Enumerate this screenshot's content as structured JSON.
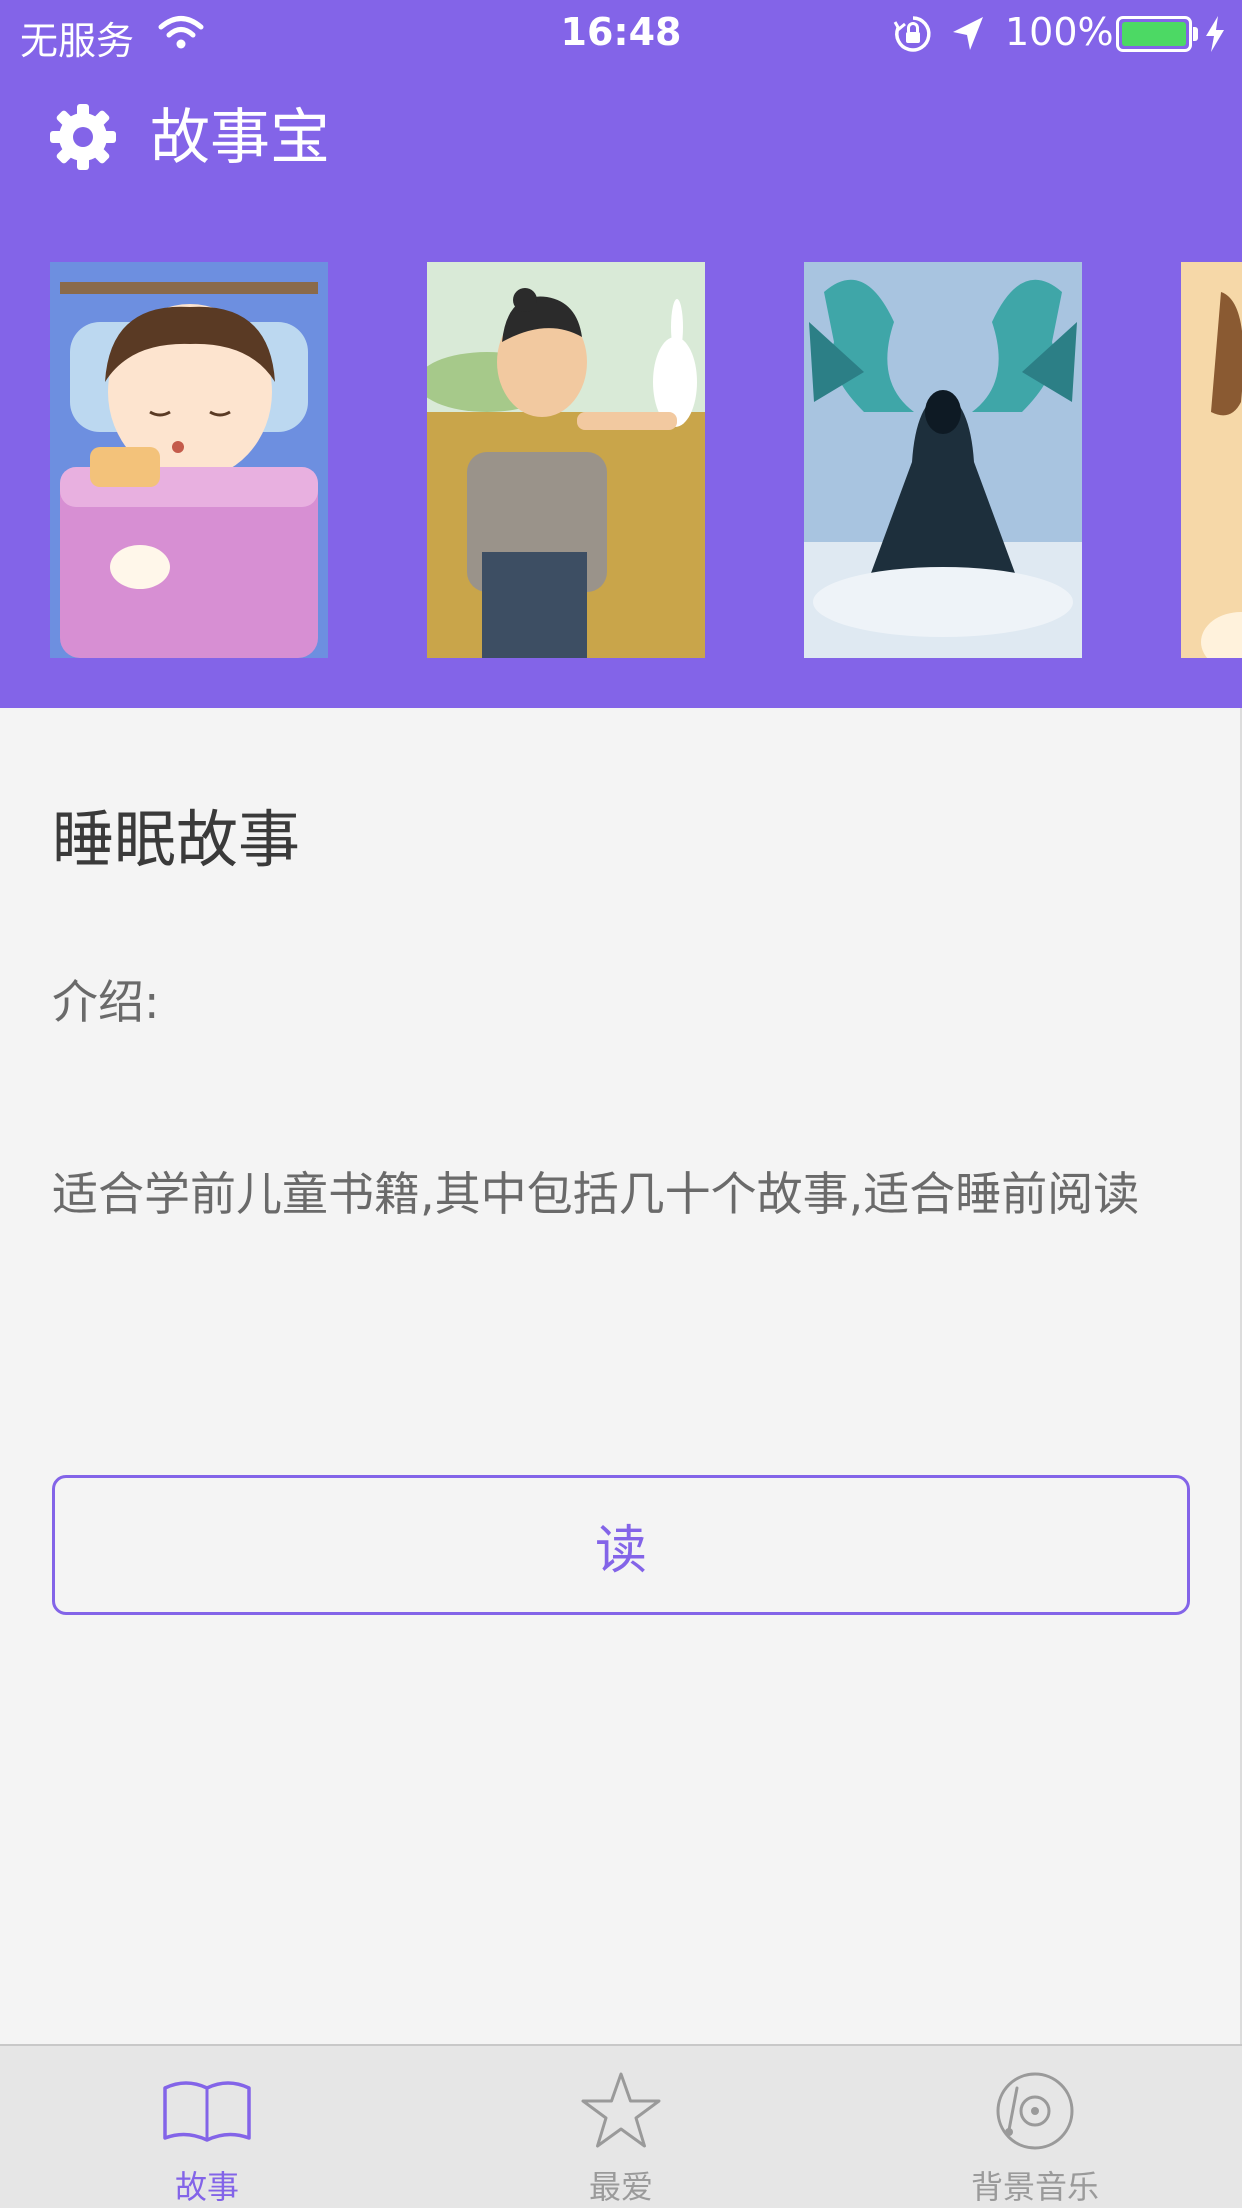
{
  "status_bar": {
    "carrier": "无服务",
    "time": "16:48",
    "battery_percent": "100%",
    "battery_level": 1.0,
    "icons": [
      "wifi-icon",
      "orientation-lock-icon",
      "location-icon",
      "battery-icon",
      "charging-icon"
    ]
  },
  "nav": {
    "title": "故事宝",
    "settings_icon": "gear-icon"
  },
  "colors": {
    "accent": "#8364e8",
    "background": "#f4f4f4",
    "battery_fill": "#4cd964",
    "tab_inactive": "#9a9a9a"
  },
  "carousel": {
    "covers": [
      {
        "name": "sleeping-child-cover"
      },
      {
        "name": "farmer-rabbit-cover"
      },
      {
        "name": "dragon-wizard-cover"
      },
      {
        "name": "partial-cover"
      }
    ]
  },
  "book": {
    "title": "睡眠故事",
    "intro_label": "介绍:",
    "description": "适合学前儿童书籍,其中包括几十个故事,适合睡前阅读",
    "read_button": "读"
  },
  "tab_bar": {
    "items": [
      {
        "label": "故事",
        "icon": "book-icon",
        "active": true
      },
      {
        "label": "最爱",
        "icon": "star-icon",
        "active": false
      },
      {
        "label": "背景音乐",
        "icon": "vinyl-record-icon",
        "active": false
      }
    ]
  }
}
